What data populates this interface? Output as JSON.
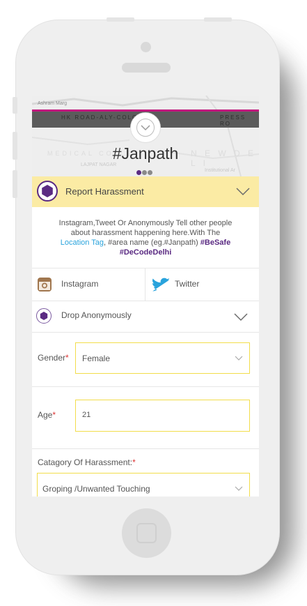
{
  "map": {
    "labels": [
      "Ashram Marg",
      "HK ROAD-ALY-COLONY",
      "PRESS RO",
      "MEDICAL COLLE",
      "N E W  D E L I",
      "LAJPAT NAGAR",
      "Institutional Ar"
    ]
  },
  "page": {
    "title": "#Janpath"
  },
  "colors": {
    "accent_purple": "#5a2a82",
    "yellow_bar": "#fbeba4",
    "field_border": "#f2dd4a",
    "link_blue": "#29a3dc",
    "map_pink": "#c2187e"
  },
  "report": {
    "label": "Report Harassment",
    "icon": "hexagon-icon",
    "chevron": "chevron-down-icon"
  },
  "info": {
    "line1": "Instagram,Tweet Or Anonymously Tell other people",
    "line2": "about harassment happening here.With The",
    "location_tag": "Location Tag",
    "mid_text": ", #area name (eg.#Janpath) ",
    "besafe": "#BeSafe",
    "decode": "#DeCodeDelhi"
  },
  "social": {
    "instagram": {
      "label": "Instagram",
      "icon": "instagram-icon"
    },
    "twitter": {
      "label": "Twitter",
      "icon": "twitter-icon"
    }
  },
  "drop": {
    "label": "Drop Anonymously",
    "icon": "hexagon-icon"
  },
  "form": {
    "gender": {
      "label": "Gender",
      "required": "*",
      "value": "Female"
    },
    "age": {
      "label": "Age",
      "required": "*",
      "value": "21"
    },
    "category": {
      "label": "Catagory Of Harassment:",
      "required": "*",
      "value": "Groping /Unwanted Touching"
    }
  }
}
